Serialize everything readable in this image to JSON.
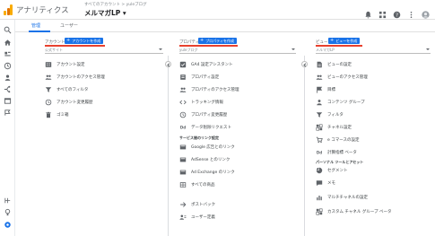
{
  "header": {
    "app_title": "アナリティクス",
    "breadcrumb": "すべてのアカウント > yuleブログ",
    "property_name": "メルマガLP ▾"
  },
  "tabs": [
    {
      "label": "管理",
      "active": true
    },
    {
      "label": "ユーザー",
      "active": false
    }
  ],
  "account": {
    "label": "アカウント",
    "create_button": "アカウントを作成",
    "selected": "公式サイト",
    "items": [
      {
        "label": "アカウント設定",
        "icon": "building-icon"
      },
      {
        "label": "アカウントのアクセス管理",
        "icon": "people-icon"
      },
      {
        "label": "すべてのフィルタ",
        "icon": "filter-icon"
      },
      {
        "label": "アカウント変更履歴",
        "icon": "history-icon"
      },
      {
        "label": "ゴミ箱",
        "icon": "trash-icon"
      }
    ]
  },
  "property": {
    "label": "プロパティ",
    "create_button": "プロパティを作成",
    "selected": "yuleブログ",
    "items": [
      {
        "label": "GA4 設定アシスタント",
        "icon": "check-box-icon"
      },
      {
        "label": "プロパティ設定",
        "icon": "property-settings-icon"
      },
      {
        "label": "プロパティのアクセス管理",
        "icon": "people-icon"
      },
      {
        "label": "トラッキング情報",
        "icon": "tracking-code-icon"
      },
      {
        "label": "プロパティ変更履歴",
        "icon": "history-icon"
      },
      {
        "label": "データ削除リクエスト",
        "icon": "dd-icon"
      }
    ],
    "section_title": "サービス間のリンク設定",
    "link_items": [
      {
        "label": "Google 広告とのリンク",
        "icon": "link-card-icon"
      },
      {
        "label": "AdSense とのリンク",
        "icon": "link-card-icon"
      },
      {
        "label": "Ad Exchange のリンク",
        "icon": "link-card-icon"
      },
      {
        "label": "すべての商品",
        "icon": "grid-card-icon"
      }
    ],
    "extra_items": [
      {
        "label": "ポストバック",
        "icon": "postback-icon"
      },
      {
        "label": "ユーザー定義",
        "icon": "user-def-icon"
      }
    ]
  },
  "view": {
    "label": "ビュー",
    "create_button": "ビューを作成",
    "selected": "メルマガLP",
    "items": [
      {
        "label": "ビューの設定",
        "icon": "document-icon"
      },
      {
        "label": "ビューのアクセス管理",
        "icon": "people-icon"
      },
      {
        "label": "目標",
        "icon": "flag-icon"
      },
      {
        "label": "コンテンツ グループ",
        "icon": "person-group-icon"
      },
      {
        "label": "フィルタ",
        "icon": "filter-icon"
      },
      {
        "label": "チャネル設定",
        "icon": "channel-icon"
      },
      {
        "label": "e コマースの設定",
        "icon": "cart-icon"
      },
      {
        "label": "計算指標 ベータ",
        "icon": "dd-icon"
      }
    ],
    "section_title": "パーソナル ツールとアセット",
    "personal_items": [
      {
        "label": "セグメント",
        "icon": "segment-icon"
      },
      {
        "label": "メモ",
        "icon": "memo-icon"
      },
      {
        "label": "マルチチャネルの設定",
        "icon": "chart-icon"
      },
      {
        "label": "カスタム チャネル グループ ベータ",
        "icon": "channel-icon"
      }
    ]
  }
}
